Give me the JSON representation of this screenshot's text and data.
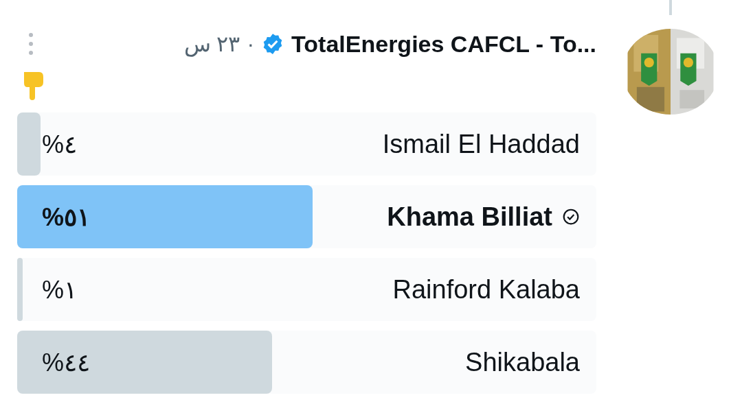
{
  "tweet": {
    "author": "TotalEnergies CAFCL - To...",
    "verified": true,
    "time": "٢٣ س",
    "separator": "·"
  },
  "poll": {
    "options": [
      {
        "label": "Ismail El Haddad",
        "percent": "%٤",
        "level": 0.04,
        "selected": false
      },
      {
        "label": "Khama Billiat",
        "percent": "%٥١",
        "level": 0.51,
        "selected": true
      },
      {
        "label": "Rainford Kalaba",
        "percent": "%١",
        "level": 0.01,
        "selected": false
      },
      {
        "label": "Shikabala",
        "percent": "%٤٤",
        "level": 0.44,
        "selected": false
      }
    ]
  }
}
